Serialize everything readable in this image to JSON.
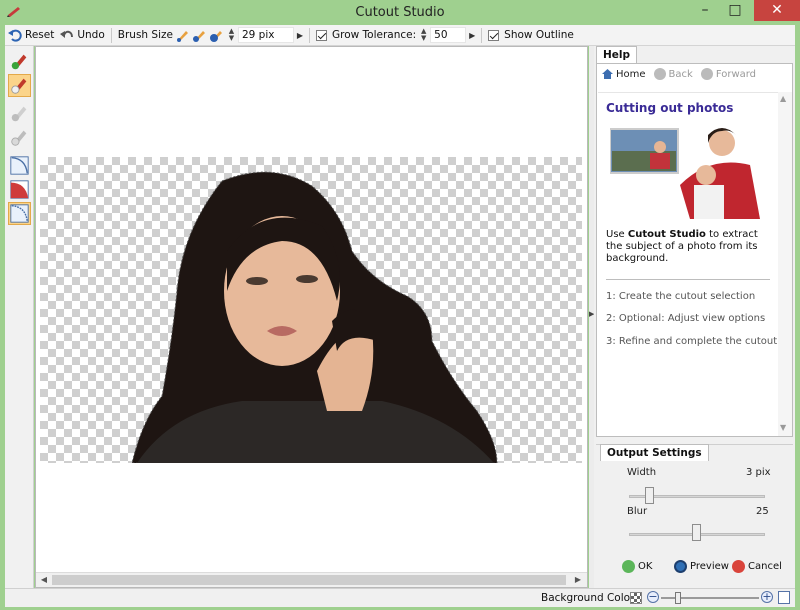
{
  "window": {
    "title": "Cutout Studio",
    "minimize": "–",
    "maximize": "□",
    "close": "✕"
  },
  "toolbar": {
    "reset": "Reset",
    "undo": "Undo",
    "brush_size_label": "Brush Size",
    "brush_size_value": "29 pix",
    "grow_tolerance_label": "Grow Tolerance:",
    "grow_tolerance_value": "50",
    "show_outline_label": "Show Outline",
    "grow_tolerance_checked": true,
    "show_outline_checked": true
  },
  "tools": [
    "foreground-marker-icon",
    "background-eraser-icon",
    "marker-disabled-icon",
    "eraser-disabled-icon",
    "shape-tool-icon",
    "shape-tool-red-icon",
    "selection-tool-icon"
  ],
  "help": {
    "tab": "Help",
    "nav": {
      "home": "Home",
      "back": "Back",
      "forward": "Forward"
    },
    "title": "Cutting out photos",
    "text_prefix": "Use ",
    "text_bold": "Cutout Studio",
    "text_suffix": " to extract the subject of a photo from its background.",
    "steps": [
      "1: Create the cutout selection",
      "2: Optional: Adjust view options",
      "3: Refine and complete the cutout"
    ]
  },
  "output": {
    "tab": "Output Settings",
    "width_label": "Width",
    "width_value": "3 pix",
    "blur_label": "Blur",
    "blur_value": "25",
    "ok": "OK",
    "preview": "Preview",
    "cancel": "Cancel"
  },
  "status": {
    "background_colour": "Background Colour"
  },
  "colors": {
    "title_bar": "#9fd08f",
    "accent_title": "#3a2b96",
    "active_tool": "#fbd48a",
    "close_button": "#c7443f"
  }
}
